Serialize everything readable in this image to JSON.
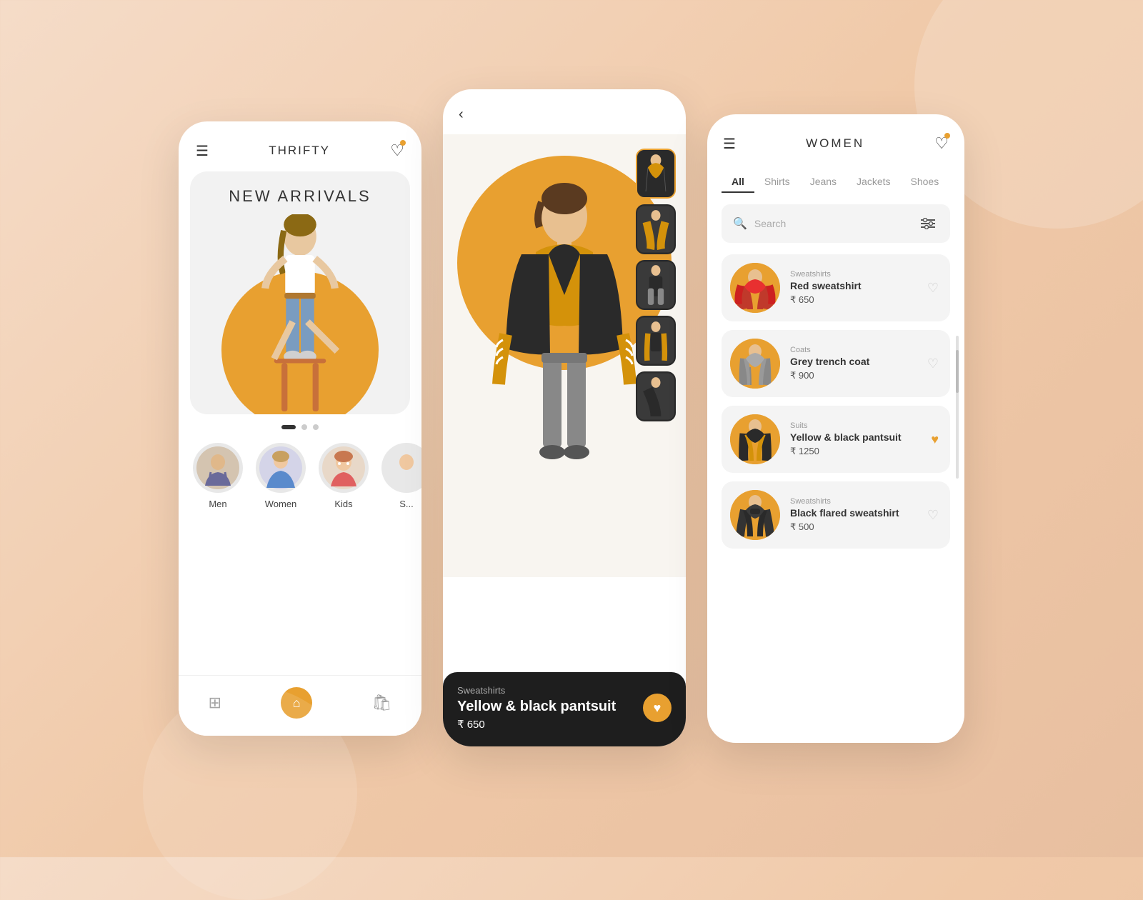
{
  "background": "#f5dcc8",
  "phone1": {
    "title": "THRIFTY",
    "banner_title": "NEW ARRIVALS",
    "dots": [
      {
        "type": "long"
      },
      {
        "type": "small"
      },
      {
        "type": "small"
      }
    ],
    "categories": [
      {
        "label": "Men",
        "emoji": "👨"
      },
      {
        "label": "Women",
        "emoji": "👩"
      },
      {
        "label": "Kids",
        "emoji": "👧"
      },
      {
        "label": "S...",
        "emoji": "👕"
      }
    ],
    "nav": [
      {
        "icon": "⊞",
        "label": "grid"
      },
      {
        "icon": "🏠",
        "label": "home",
        "active": true
      },
      {
        "icon": "🛍",
        "label": "bag"
      }
    ]
  },
  "phone2": {
    "product": {
      "category": "Sweatshirts",
      "name": "Yellow & black pantsuit",
      "price": "₹ 650",
      "liked": true
    },
    "thumbnails": [
      {
        "id": 1,
        "active": true
      },
      {
        "id": 2
      },
      {
        "id": 3
      },
      {
        "id": 4
      },
      {
        "id": 5
      }
    ]
  },
  "phone3": {
    "title": "WOMEN",
    "tabs": [
      {
        "label": "All",
        "active": true
      },
      {
        "label": "Shirts"
      },
      {
        "label": "Jeans"
      },
      {
        "label": "Jackets"
      },
      {
        "label": "Shoes"
      }
    ],
    "search_placeholder": "Search",
    "products": [
      {
        "category": "Sweatshirts",
        "name": "Red sweatshirt",
        "price": "₹ 650",
        "liked": false,
        "color": "#c0392b"
      },
      {
        "category": "Coats",
        "name": "Grey trench coat",
        "price": "₹ 900",
        "liked": false,
        "color": "#999"
      },
      {
        "category": "Suits",
        "name": "Yellow & black pantsuit",
        "price": "₹ 1250",
        "liked": true,
        "color": "#2a2a2a"
      },
      {
        "category": "Sweatshirts",
        "name": "Black flared sweatshirt",
        "price": "₹ 500",
        "liked": false,
        "color": "#333"
      }
    ]
  }
}
